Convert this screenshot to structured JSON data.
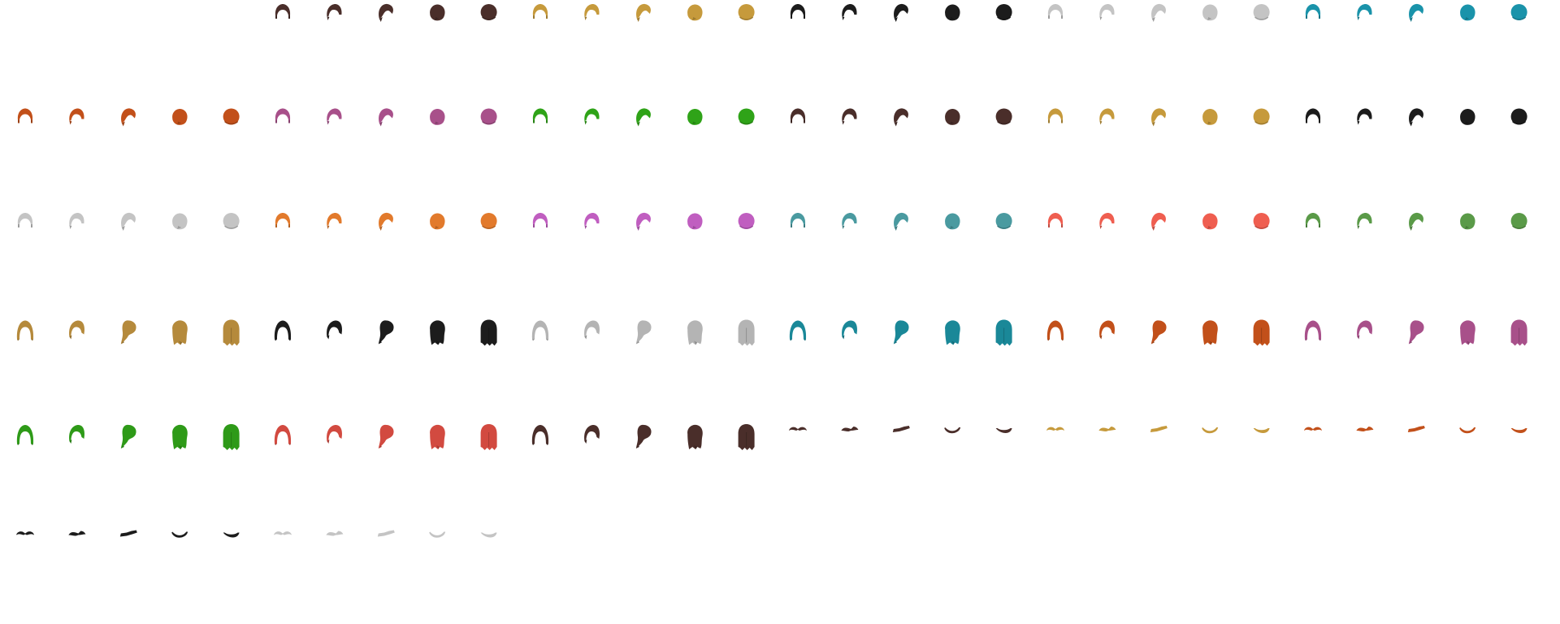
{
  "sprite_sheet": {
    "background": "#ffffff",
    "sprite_icon": "hair-sprite-icon",
    "angles_per_group": 5,
    "groups": [
      {
        "style": "short",
        "color": "#4a2e2a"
      },
      {
        "style": "short",
        "color": "#c69a3c"
      },
      {
        "style": "short",
        "color": "#1c1c1c"
      },
      {
        "style": "short",
        "color": "#c4c4c4"
      },
      {
        "style": "short",
        "color": "#1a93aa"
      },
      {
        "style": "short",
        "color": "#c2501a"
      },
      {
        "style": "short",
        "color": "#a8508a"
      },
      {
        "style": "short",
        "color": "#2fa318"
      },
      {
        "style": "short",
        "color": "#4a2e2a"
      },
      {
        "style": "short",
        "color": "#c69a3c"
      },
      {
        "style": "short",
        "color": "#1c1c1c"
      },
      {
        "style": "short",
        "color": "#c4c4c4"
      },
      {
        "style": "short",
        "color": "#e27a2c"
      },
      {
        "style": "short",
        "color": "#c05ec0"
      },
      {
        "style": "short",
        "color": "#4a9aa0"
      },
      {
        "style": "short",
        "color": "#ef5e50"
      },
      {
        "style": "short",
        "color": "#5a9a48"
      },
      {
        "style": "long",
        "color": "#b58a3c"
      },
      {
        "style": "long",
        "color": "#1c1c1c"
      },
      {
        "style": "long",
        "color": "#b4b4b4"
      },
      {
        "style": "long",
        "color": "#1a8898"
      },
      {
        "style": "long",
        "color": "#c2501a"
      },
      {
        "style": "long",
        "color": "#a8508a"
      },
      {
        "style": "long",
        "color": "#2e9a18"
      },
      {
        "style": "long",
        "color": "#d24a40"
      },
      {
        "style": "long",
        "color": "#4a2e2a"
      },
      {
        "style": "mustache",
        "color": "#4a2e2a"
      },
      {
        "style": "mustache",
        "color": "#c69a3c"
      },
      {
        "style": "mustache",
        "color": "#c2501a"
      },
      {
        "style": "mustache",
        "color": "#1c1c1c"
      },
      {
        "style": "mustache",
        "color": "#c4c4c4"
      }
    ]
  }
}
